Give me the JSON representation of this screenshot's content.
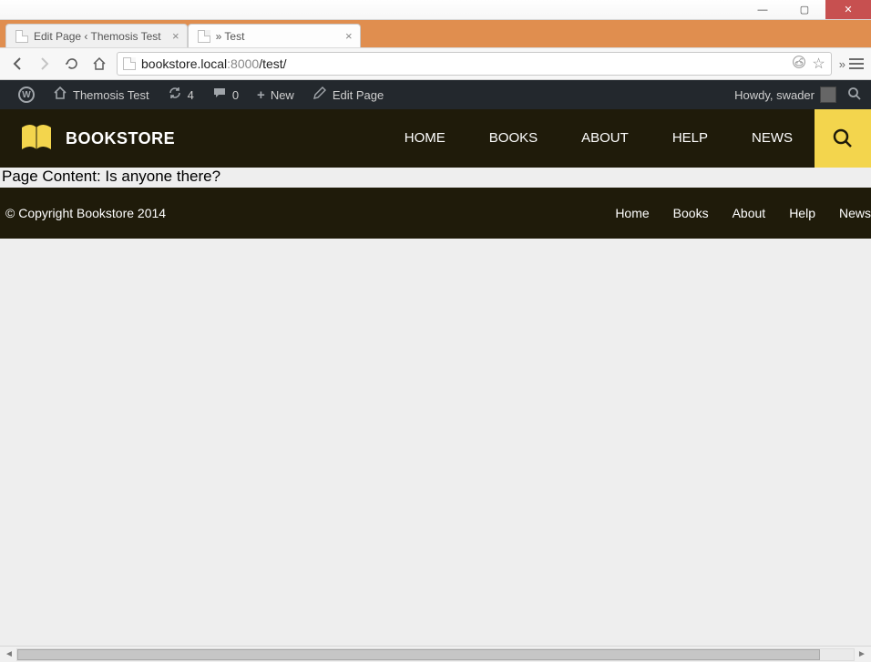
{
  "window": {
    "minimize": "—",
    "maximize": "▢",
    "close": "✕"
  },
  "tabs": [
    {
      "title": "Edit Page ‹ Themosis Test",
      "active": false
    },
    {
      "title": " » Test",
      "active": true
    }
  ],
  "address": {
    "host": "bookstore.local",
    "port": ":8000",
    "path": "/test/"
  },
  "adminbar": {
    "site_name": "Themosis Test",
    "updates_count": "4",
    "comments_count": "0",
    "new_label": "New",
    "edit_label": "Edit Page",
    "howdy_prefix": "Howdy, ",
    "user": "swader"
  },
  "brand": "BOOKSTORE",
  "main_nav": [
    "HOME",
    "BOOKS",
    "ABOUT",
    "HELP",
    "NEWS"
  ],
  "page_content": "Page Content: Is anyone there?",
  "footer": {
    "copyright": "© Copyright Bookstore 2014",
    "nav": [
      "Home",
      "Books",
      "About",
      "Help",
      "News"
    ]
  }
}
